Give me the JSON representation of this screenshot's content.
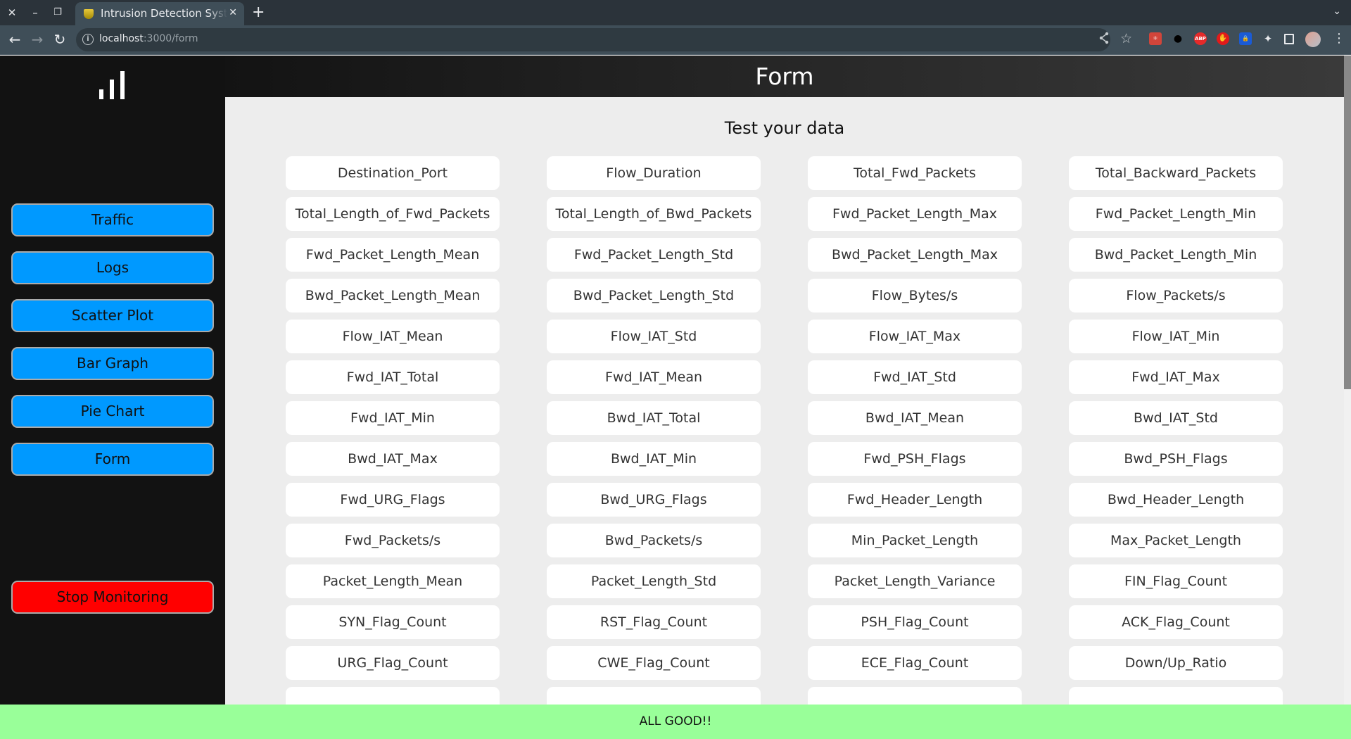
{
  "browser": {
    "tab_title": "Intrusion Detection System",
    "url_host": "localhost",
    "url_path": ":3000/form",
    "window_controls": {
      "close": "✕",
      "minimize": "–",
      "restore": "❐"
    },
    "new_tab": "+",
    "tab_list": "⌄",
    "nav": {
      "back": "←",
      "forward": "→",
      "reload": "↻"
    },
    "omni_icons": {
      "info": "i",
      "share": "share-icon",
      "star": "☆"
    },
    "extensions": [
      {
        "name": "react-devtools",
        "label": "⚛",
        "color": "#d2453a"
      },
      {
        "name": "gnome",
        "label": "🐾",
        "color": "#000000"
      },
      {
        "name": "adblock-plus",
        "label": "ABP",
        "color": "#e62a2a"
      },
      {
        "name": "adblock",
        "label": "✋",
        "color": "#e21a1a"
      },
      {
        "name": "bitwarden",
        "label": "🔒",
        "color": "#1a5bd6"
      },
      {
        "name": "extensions",
        "label": "✦",
        "color": "transparent"
      },
      {
        "name": "side-panel",
        "label": "▮",
        "color": "transparent"
      }
    ],
    "kebab": "⋮"
  },
  "sidebar": {
    "logo": "bar-chart-logo",
    "items": [
      {
        "label": "Traffic"
      },
      {
        "label": "Logs"
      },
      {
        "label": "Scatter Plot"
      },
      {
        "label": "Bar Graph"
      },
      {
        "label": "Pie Chart"
      },
      {
        "label": "Form"
      }
    ],
    "stop_label": "Stop Monitoring",
    "stop_color": "#ff0000",
    "nav_color": "#0099ff"
  },
  "header": {
    "title": "Form"
  },
  "form": {
    "title": "Test your data",
    "fields": [
      {
        "placeholder": "Destination_Port",
        "value": ""
      },
      {
        "placeholder": "Flow_Duration",
        "value": ""
      },
      {
        "placeholder": "Total_Fwd_Packets",
        "value": ""
      },
      {
        "placeholder": "Total_Backward_Packets",
        "value": ""
      },
      {
        "placeholder": "Total_Length_of_Fwd_Packets",
        "value": ""
      },
      {
        "placeholder": "Total_Length_of_Bwd_Packets",
        "value": ""
      },
      {
        "placeholder": "Fwd_Packet_Length_Max",
        "value": ""
      },
      {
        "placeholder": "Fwd_Packet_Length_Min",
        "value": ""
      },
      {
        "placeholder": "Fwd_Packet_Length_Mean",
        "value": ""
      },
      {
        "placeholder": "Fwd_Packet_Length_Std",
        "value": ""
      },
      {
        "placeholder": "Bwd_Packet_Length_Max",
        "value": ""
      },
      {
        "placeholder": "Bwd_Packet_Length_Min",
        "value": ""
      },
      {
        "placeholder": "Bwd_Packet_Length_Mean",
        "value": ""
      },
      {
        "placeholder": "Bwd_Packet_Length_Std",
        "value": ""
      },
      {
        "placeholder": "Flow_Bytes/s",
        "value": ""
      },
      {
        "placeholder": "Flow_Packets/s",
        "value": ""
      },
      {
        "placeholder": "Flow_IAT_Mean",
        "value": ""
      },
      {
        "placeholder": "Flow_IAT_Std",
        "value": ""
      },
      {
        "placeholder": "Flow_IAT_Max",
        "value": ""
      },
      {
        "placeholder": "Flow_IAT_Min",
        "value": ""
      },
      {
        "placeholder": "Fwd_IAT_Total",
        "value": ""
      },
      {
        "placeholder": "Fwd_IAT_Mean",
        "value": ""
      },
      {
        "placeholder": "Fwd_IAT_Std",
        "value": ""
      },
      {
        "placeholder": "Fwd_IAT_Max",
        "value": ""
      },
      {
        "placeholder": "Fwd_IAT_Min",
        "value": ""
      },
      {
        "placeholder": "Bwd_IAT_Total",
        "value": ""
      },
      {
        "placeholder": "Bwd_IAT_Mean",
        "value": ""
      },
      {
        "placeholder": "Bwd_IAT_Std",
        "value": ""
      },
      {
        "placeholder": "Bwd_IAT_Max",
        "value": ""
      },
      {
        "placeholder": "Bwd_IAT_Min",
        "value": ""
      },
      {
        "placeholder": "Fwd_PSH_Flags",
        "value": ""
      },
      {
        "placeholder": "Bwd_PSH_Flags",
        "value": ""
      },
      {
        "placeholder": "Fwd_URG_Flags",
        "value": ""
      },
      {
        "placeholder": "Bwd_URG_Flags",
        "value": ""
      },
      {
        "placeholder": "Fwd_Header_Length",
        "value": ""
      },
      {
        "placeholder": "Bwd_Header_Length",
        "value": ""
      },
      {
        "placeholder": "Fwd_Packets/s",
        "value": ""
      },
      {
        "placeholder": "Bwd_Packets/s",
        "value": ""
      },
      {
        "placeholder": "Min_Packet_Length",
        "value": ""
      },
      {
        "placeholder": "Max_Packet_Length",
        "value": ""
      },
      {
        "placeholder": "Packet_Length_Mean",
        "value": ""
      },
      {
        "placeholder": "Packet_Length_Std",
        "value": ""
      },
      {
        "placeholder": "Packet_Length_Variance",
        "value": ""
      },
      {
        "placeholder": "FIN_Flag_Count",
        "value": ""
      },
      {
        "placeholder": "SYN_Flag_Count",
        "value": ""
      },
      {
        "placeholder": "RST_Flag_Count",
        "value": ""
      },
      {
        "placeholder": "PSH_Flag_Count",
        "value": ""
      },
      {
        "placeholder": "ACK_Flag_Count",
        "value": ""
      },
      {
        "placeholder": "URG_Flag_Count",
        "value": ""
      },
      {
        "placeholder": "CWE_Flag_Count",
        "value": ""
      },
      {
        "placeholder": "ECE_Flag_Count",
        "value": ""
      },
      {
        "placeholder": "Down/Up_Ratio",
        "value": ""
      },
      {
        "placeholder": "",
        "value": ""
      },
      {
        "placeholder": "",
        "value": ""
      },
      {
        "placeholder": "",
        "value": ""
      },
      {
        "placeholder": "",
        "value": ""
      }
    ]
  },
  "status": {
    "text": "ALL GOOD!!",
    "color": "#99ff99"
  }
}
